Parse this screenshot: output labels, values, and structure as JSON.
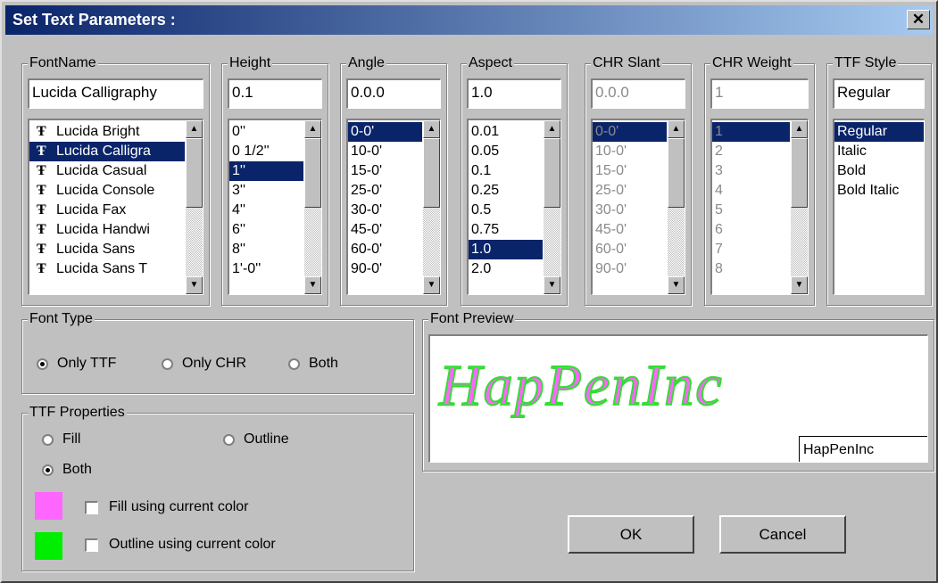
{
  "window": {
    "title": "Set Text Parameters :",
    "close_label": "✕"
  },
  "fontname": {
    "label": "FontName",
    "value": "Lucida Calligraphy",
    "items": [
      "Lucida Bright",
      "Lucida Calligra",
      "Lucida Casual",
      "Lucida Console",
      "Lucida Fax",
      "Lucida Handwi",
      "Lucida Sans",
      "Lucida Sans T"
    ],
    "selected_index": 1,
    "item_icon": "truetype-icon",
    "item_icon_glyph": "Ŧ"
  },
  "height": {
    "label": "Height",
    "value": "0.1",
    "items": [
      "0''",
      "0 1/2''",
      "1''",
      "3''",
      "4''",
      "6''",
      "8''",
      "1'-0''"
    ],
    "selected_index": 2
  },
  "angle": {
    "label": "Angle",
    "value": "0.0.0",
    "items": [
      "0-0'",
      "10-0'",
      "15-0'",
      "25-0'",
      "30-0'",
      "45-0'",
      "60-0'",
      "90-0'"
    ],
    "selected_index": 0
  },
  "aspect": {
    "label": "Aspect",
    "value": "1.0",
    "items": [
      "0.01",
      "0.05",
      "0.1",
      "0.25",
      "0.5",
      "0.75",
      "1.0",
      "2.0"
    ],
    "selected_index": 6
  },
  "chr_slant": {
    "label": "CHR Slant",
    "value": "0.0.0",
    "items": [
      "0-0'",
      "10-0'",
      "15-0'",
      "25-0'",
      "30-0'",
      "45-0'",
      "60-0'",
      "90-0'"
    ],
    "selected_index": 0
  },
  "chr_weight": {
    "label": "CHR Weight",
    "value": "1",
    "items": [
      "1",
      "2",
      "3",
      "4",
      "5",
      "6",
      "7",
      "8"
    ],
    "selected_index": 0
  },
  "ttf_style": {
    "label": "TTF Style",
    "value": "Regular",
    "items": [
      "Regular",
      "Italic",
      "Bold",
      "Bold Italic"
    ],
    "selected_index": 0
  },
  "font_type": {
    "label": "Font Type",
    "options": [
      {
        "label": "Only TTF",
        "checked": true
      },
      {
        "label": "Only CHR",
        "checked": false
      },
      {
        "label": "Both",
        "checked": false
      }
    ]
  },
  "ttf_properties": {
    "label": "TTF Properties",
    "fill_label": "Fill",
    "outline_label": "Outline",
    "both_label": "Both",
    "selected": "Both",
    "fill_color_label": "Fill using current color",
    "fill_color": "#ff66ff",
    "outline_color_label": "Outline using current color",
    "outline_color": "#00ee00"
  },
  "preview": {
    "label": "Font Preview",
    "text": "HapPenInc",
    "input_value": "HapPenInc"
  },
  "buttons": {
    "ok": "OK",
    "cancel": "Cancel"
  }
}
